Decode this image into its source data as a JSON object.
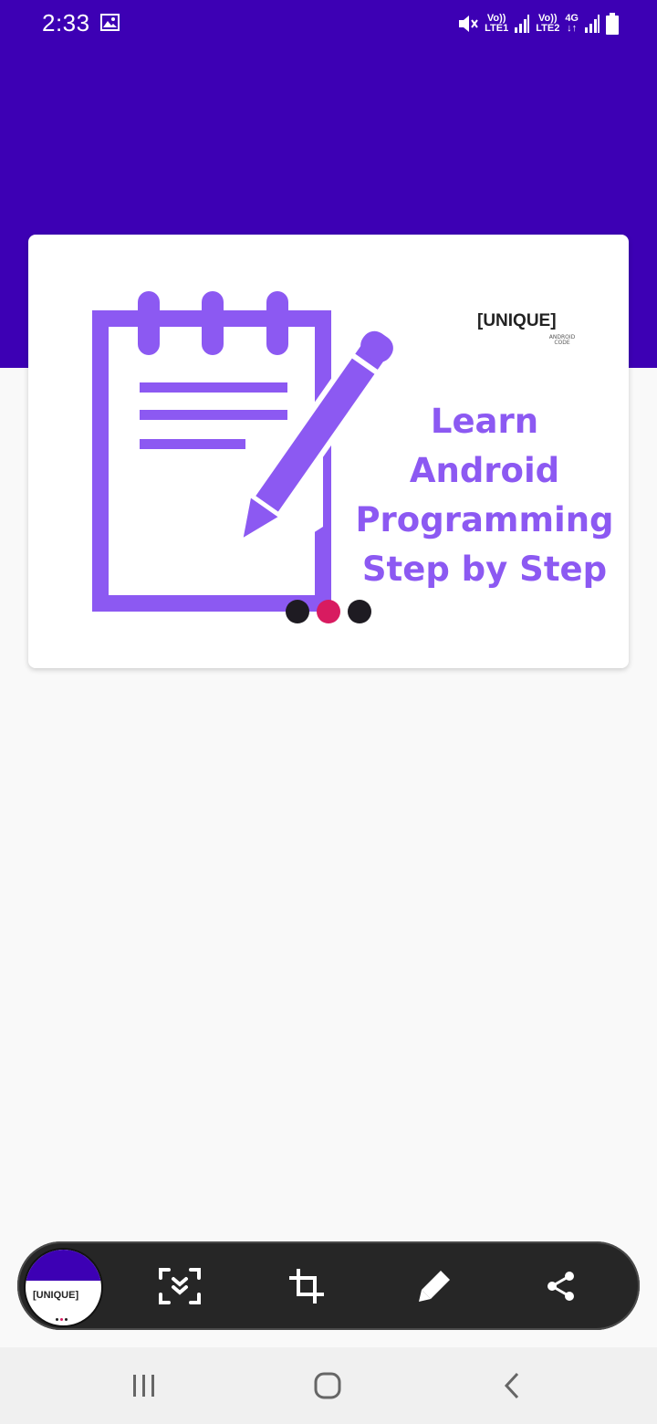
{
  "status_bar": {
    "time": "2:33",
    "sim1_top": "Vo))",
    "sim1_bottom": "LTE1",
    "sim2_top": "Vo))",
    "sim2_bottom": "LTE2",
    "network": "4G",
    "icons": [
      "gallery-icon",
      "mute-icon",
      "signal-icon",
      "signal-icon",
      "signal-icon",
      "battery-icon"
    ]
  },
  "colors": {
    "app_bar": "#3d00b4",
    "headline": "#8c59f2",
    "dot_active": "#d81b60",
    "dot_inactive": "#1e1b22"
  },
  "slider": {
    "brand_logo": "[UNIQUE]",
    "brand_sub": "ANDROID CODE",
    "headline": [
      "Learn",
      "Android",
      "Programming",
      "Step by Step"
    ],
    "total_slides": 3,
    "active_slide": 2
  },
  "screenshot_toolbar": {
    "thumbnail_logo": "[UNIQUE]",
    "icons": [
      "scroll-capture-icon",
      "crop-icon",
      "pencil-icon",
      "share-icon"
    ]
  },
  "nav_bar": {
    "icons": [
      "recents-icon",
      "home-icon",
      "back-icon"
    ]
  }
}
